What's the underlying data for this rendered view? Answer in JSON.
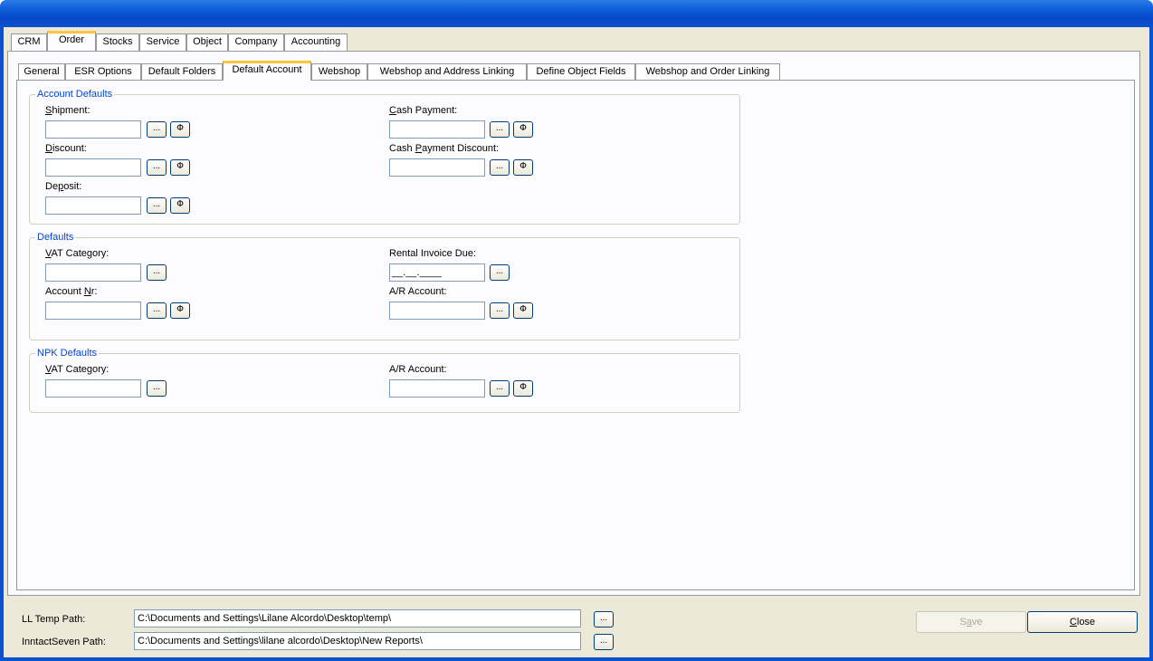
{
  "main_tabs": [
    {
      "label": "CRM",
      "active": false
    },
    {
      "label": "Order",
      "active": true
    },
    {
      "label": "Stocks",
      "active": false
    },
    {
      "label": "Service",
      "active": false
    },
    {
      "label": "Object",
      "active": false
    },
    {
      "label": "Company",
      "active": false
    },
    {
      "label": "Accounting",
      "active": false
    }
  ],
  "sub_tabs": [
    {
      "label": "General",
      "active": false
    },
    {
      "label": "ESR Options",
      "active": false
    },
    {
      "label": "Default Folders",
      "active": false
    },
    {
      "label": "Default Account",
      "active": true
    },
    {
      "label": "Webshop",
      "active": false
    },
    {
      "label": "Webshop and Address Linking",
      "active": false
    },
    {
      "label": "Define Object Fields",
      "active": false
    },
    {
      "label": "Webshop and Order Linking",
      "active": false
    }
  ],
  "account_defaults": {
    "title": "Account Defaults",
    "shipment": {
      "label_pre": "",
      "label_u": "S",
      "label_post": "hipment:",
      "value": ""
    },
    "discount": {
      "label_pre": "",
      "label_u": "D",
      "label_post": "iscount:",
      "value": ""
    },
    "deposit": {
      "label_pre": "De",
      "label_u": "p",
      "label_post": "osit:",
      "value": ""
    },
    "cash_payment": {
      "label_pre": "",
      "label_u": "C",
      "label_post": "ash Payment:",
      "value": ""
    },
    "cash_payment_discount": {
      "label_pre": "Cash ",
      "label_u": "P",
      "label_post": "ayment Discount:",
      "value": ""
    }
  },
  "defaults": {
    "title": "Defaults",
    "vat_category": {
      "label_pre": "",
      "label_u": "V",
      "label_post": "AT Category:",
      "value": ""
    },
    "account_nr": {
      "label_pre": "Account ",
      "label_u": "N",
      "label_post": "r:",
      "value": ""
    },
    "rental_invoice_due": {
      "label": "Rental Invoice Due:",
      "value": "__.__.____"
    },
    "ar_account": {
      "label": "A/R Account:",
      "value": ""
    }
  },
  "npk_defaults": {
    "title": "NPK Defaults",
    "vat_category": {
      "label_pre": "",
      "label_u": "V",
      "label_post": "AT Category:",
      "value": ""
    },
    "ar_account": {
      "label": "A/R Account:",
      "value": ""
    }
  },
  "buttons": {
    "browse": "...",
    "phi": "Φ"
  },
  "footer": {
    "ll_temp_path": {
      "label": "LL Temp Path:",
      "value": "C:\\Documents and Settings\\Lilane Alcordo\\Desktop\\temp\\"
    },
    "inntactseven_path": {
      "label": "InntactSeven Path:",
      "value": "C:\\Documents and Settings\\lilane alcordo\\Desktop\\New Reports\\"
    },
    "save_pre": "S",
    "save_u": "a",
    "save_post": "ve",
    "close_pre": "",
    "close_u": "C",
    "close_post": "lose"
  }
}
